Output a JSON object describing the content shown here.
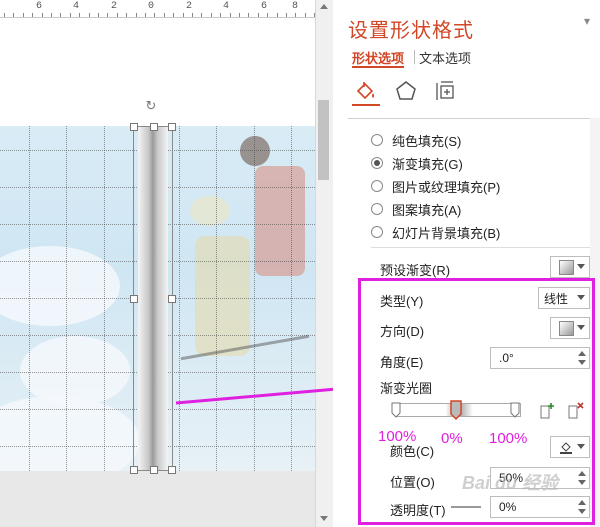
{
  "ruler": {
    "labels": [
      "6",
      "4",
      "2",
      "0",
      "2",
      "4",
      "6",
      "8"
    ]
  },
  "panel": {
    "title": "设置形状格式",
    "close_glyph": "▾",
    "tabs": [
      {
        "label": "形状选项",
        "active": true
      },
      {
        "label": "文本选项",
        "active": false
      }
    ],
    "categories": [
      {
        "icon": "fill-line-icon",
        "active": true
      },
      {
        "icon": "effects-pentagon-icon",
        "active": false
      },
      {
        "icon": "size-layout-icon",
        "active": false
      }
    ]
  },
  "fill": {
    "options": [
      {
        "label": "纯色填充(S)",
        "selected": false
      },
      {
        "label": "渐变填充(G)",
        "selected": true
      },
      {
        "label": "图片或纹理填充(P)",
        "selected": false
      },
      {
        "label": "图案填充(A)",
        "selected": false
      },
      {
        "label": "幻灯片背景填充(B)",
        "selected": false
      }
    ],
    "preset_label": "预设渐变(R)",
    "type_label": "类型(Y)",
    "type_value": "线性",
    "direction_label": "方向(D)",
    "angle_label": "角度(E)",
    "angle_value": ".0°",
    "stops_label": "渐变光圈",
    "color_label": "颜色(C)",
    "position_label": "位置(O)",
    "position_value": "50%",
    "transparency_label": "透明度(T)",
    "transparency_value": "0%",
    "add_stop_title": "添加渐变光圈",
    "remove_stop_title": "删除渐变光圈"
  },
  "annotations": {
    "stop_left": "100%",
    "stop_mid": "0%",
    "stop_right": "100%",
    "color": "#e020e0"
  },
  "watermark": "Bai du 经验",
  "colors": {
    "accent": "#d24726",
    "highlight": "#e020e0"
  }
}
